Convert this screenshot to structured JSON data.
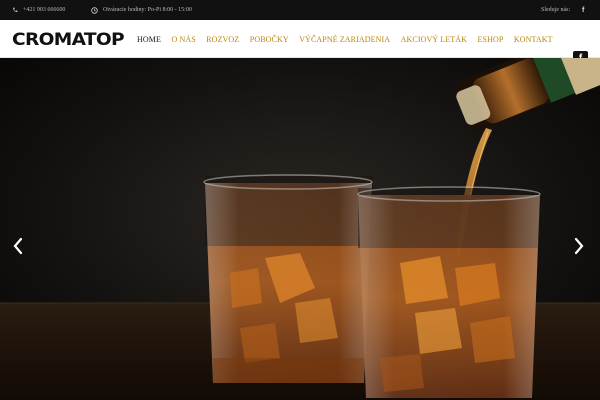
{
  "topbar": {
    "phone": "+421 903 666600",
    "hours": "Otváracie hodiny: Po-Pi 8:00 - 15:00",
    "follow": "Sleduje nás:",
    "fb": "f"
  },
  "logo": {
    "text": "CROMATOP"
  },
  "menu": {
    "items": [
      "HOME",
      "O NÁS",
      "ROZVOZ",
      "POBOČKY",
      "VÝČAPNÉ ZARIADENIA",
      "AKCIOVÝ LETÁK",
      "ESHOP",
      "KONTAKT"
    ],
    "active": "HOME"
  },
  "social": {
    "fb": "f"
  },
  "colors": {
    "accent": "#b8860b",
    "dark": "#111111",
    "topbar": "#111111"
  },
  "icons": {
    "phone": "phone-icon",
    "clock": "clock-icon",
    "prev": "chevron-left-icon",
    "next": "chevron-right-icon"
  }
}
